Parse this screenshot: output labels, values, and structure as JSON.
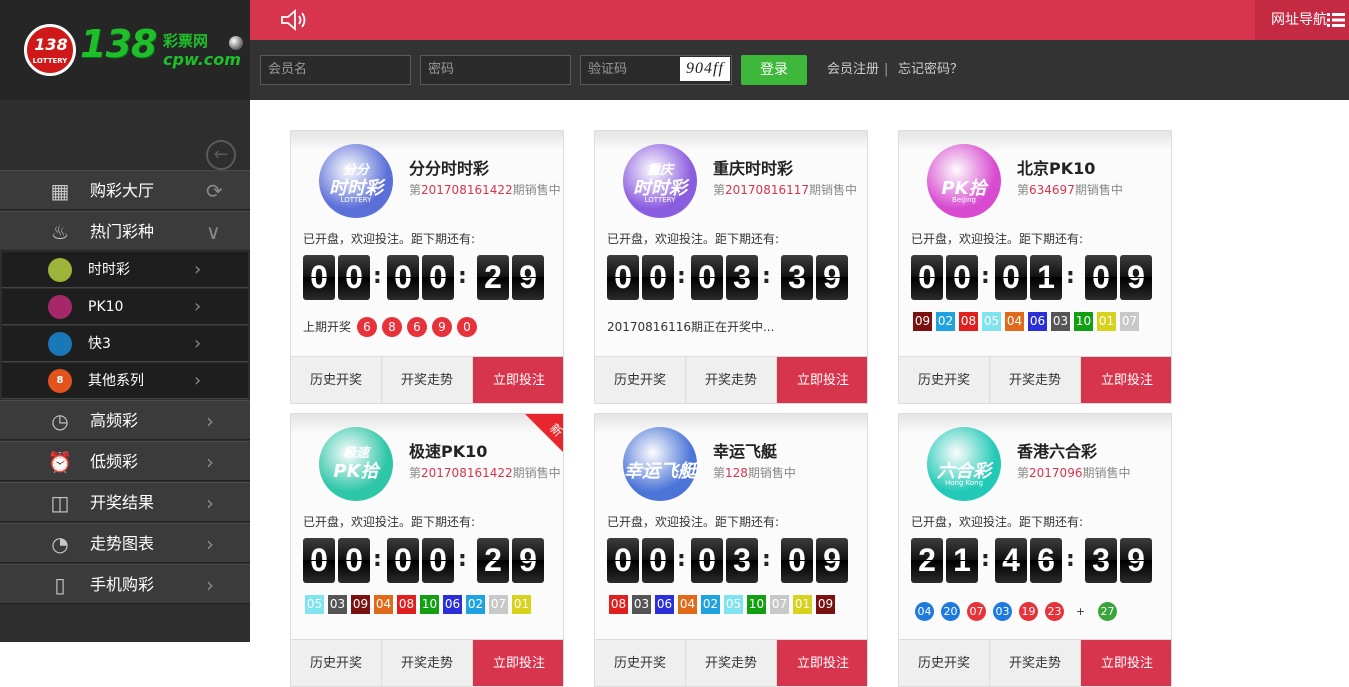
{
  "brand": {
    "disc_number": "138",
    "disc_text": "LOTTERY",
    "big_text": "138",
    "cn_text": "彩票网",
    "url_text": "cpw.com"
  },
  "sidebar": {
    "menu": [
      {
        "label": "购彩大厅",
        "icon": "grid-icon"
      },
      {
        "label": "热门彩种",
        "icon": "flame-icon"
      },
      {
        "label": "高频彩",
        "icon": "stopwatch-icon"
      },
      {
        "label": "低频彩",
        "icon": "alarm-clock-icon"
      },
      {
        "label": "开奖结果",
        "icon": "trophy-icon"
      },
      {
        "label": "走势图表",
        "icon": "trend-chart-icon"
      },
      {
        "label": "手机购彩",
        "icon": "mobile-phone-icon"
      }
    ],
    "submenu": [
      {
        "label": "时时彩",
        "icon": "ssc-ball-icon",
        "color": "#9db33a"
      },
      {
        "label": "PK10",
        "icon": "pk10-ball-icon",
        "color": "#a5286a"
      },
      {
        "label": "快3",
        "icon": "k3-ball-icon",
        "color": "#1b78b8"
      },
      {
        "label": "其他系列",
        "icon": "eight-ball-icon",
        "color": "#e2531d",
        "glyph": "8"
      }
    ]
  },
  "header": {
    "speaker_icon": "speaker-icon",
    "nav_label": "网址导航",
    "login": {
      "username_placeholder": "会员名",
      "password_placeholder": "密码",
      "captcha_placeholder": "验证码",
      "captcha_text": "904ff",
      "login_button": "登录",
      "register_link": "会员注册",
      "separator": "|",
      "forgot_link": "忘记密码？"
    }
  },
  "cards": [
    {
      "title": "分分时时彩",
      "issue_prefix": "第",
      "issue": "201708161422",
      "issue_suffix": "期销售中",
      "logo": {
        "line1": "分分",
        "line2": "时时彩",
        "line3": "LOTTERY",
        "color": "#5b6fd9"
      },
      "status": "已开盘，欢迎投注。距下期还有:",
      "countdown": [
        "0",
        "0",
        "0",
        "0",
        "2",
        "9"
      ],
      "prev_label": "上期开奖",
      "prev_balls": [
        "6",
        "8",
        "6",
        "9",
        "0"
      ],
      "buttons": [
        "历史开奖",
        "开奖走势",
        "立即投注"
      ]
    },
    {
      "title": "重庆时时彩",
      "issue_prefix": "第",
      "issue": "20170816117",
      "issue_suffix": "期销售中",
      "logo": {
        "line1": "重庆",
        "line2": "时时彩",
        "line3": "LOTTERY",
        "color": "#8a5ce0"
      },
      "status": "已开盘，欢迎投注。距下期还有:",
      "countdown": [
        "0",
        "0",
        "0",
        "3",
        "3",
        "9"
      ],
      "prev_text": "20170816116期正在开奖中...",
      "buttons": [
        "历史开奖",
        "开奖走势",
        "立即投注"
      ]
    },
    {
      "title": "北京PK10",
      "issue_prefix": "第",
      "issue": "634697",
      "issue_suffix": "期销售中",
      "logo": {
        "line1": "",
        "line2": "PK拾",
        "line3": "BeiJing",
        "color": "#d84ad0"
      },
      "status": "已开盘，欢迎投注。距下期还有:",
      "countdown": [
        "0",
        "0",
        "0",
        "1",
        "0",
        "9"
      ],
      "pk_balls": [
        {
          "n": "09",
          "c": "#7a1010"
        },
        {
          "n": "02",
          "c": "#1fa3e0"
        },
        {
          "n": "08",
          "c": "#e01f1f"
        },
        {
          "n": "05",
          "c": "#7fe3f0"
        },
        {
          "n": "04",
          "c": "#e06a1a"
        },
        {
          "n": "06",
          "c": "#2b2fd8"
        },
        {
          "n": "03",
          "c": "#555555"
        },
        {
          "n": "10",
          "c": "#12a012"
        },
        {
          "n": "01",
          "c": "#d8d21c"
        },
        {
          "n": "07",
          "c": "#c8c8c8"
        }
      ],
      "buttons": [
        "历史开奖",
        "开奖走势",
        "立即投注"
      ]
    },
    {
      "title": "极速PK10",
      "issue_prefix": "第",
      "issue": "201708161422",
      "issue_suffix": "期销售中",
      "logo": {
        "line1": "极速",
        "line2": "PK拾",
        "line3": "",
        "color": "#2ec6a8"
      },
      "ribbon": "新",
      "status": "已开盘，欢迎投注。距下期还有:",
      "countdown": [
        "0",
        "0",
        "0",
        "0",
        "2",
        "9"
      ],
      "pk_balls": [
        {
          "n": "05",
          "c": "#7fe3f0"
        },
        {
          "n": "03",
          "c": "#555555"
        },
        {
          "n": "09",
          "c": "#7a1010"
        },
        {
          "n": "04",
          "c": "#e06a1a"
        },
        {
          "n": "08",
          "c": "#e01f1f"
        },
        {
          "n": "10",
          "c": "#12a012"
        },
        {
          "n": "06",
          "c": "#2b2fd8"
        },
        {
          "n": "02",
          "c": "#1fa3e0"
        },
        {
          "n": "07",
          "c": "#c8c8c8"
        },
        {
          "n": "01",
          "c": "#d8d21c"
        }
      ],
      "buttons": [
        "历史开奖",
        "开奖走势",
        "立即投注"
      ]
    },
    {
      "title": "幸运飞艇",
      "issue_prefix": "第",
      "issue": "128",
      "issue_suffix": "期销售中",
      "logo": {
        "line1": "",
        "line2": "幸运飞艇",
        "line3": "",
        "color": "#4a74d8"
      },
      "status": "已开盘，欢迎投注。距下期还有:",
      "countdown": [
        "0",
        "0",
        "0",
        "3",
        "0",
        "9"
      ],
      "pk_balls": [
        {
          "n": "08",
          "c": "#e01f1f"
        },
        {
          "n": "03",
          "c": "#555555"
        },
        {
          "n": "06",
          "c": "#2b2fd8"
        },
        {
          "n": "04",
          "c": "#e06a1a"
        },
        {
          "n": "02",
          "c": "#1fa3e0"
        },
        {
          "n": "05",
          "c": "#7fe3f0"
        },
        {
          "n": "10",
          "c": "#12a012"
        },
        {
          "n": "07",
          "c": "#c8c8c8"
        },
        {
          "n": "01",
          "c": "#d8d21c"
        },
        {
          "n": "09",
          "c": "#7a1010"
        }
      ],
      "buttons": [
        "历史开奖",
        "开奖走势",
        "立即投注"
      ]
    },
    {
      "title": "香港六合彩",
      "issue_prefix": "第",
      "issue": "2017096",
      "issue_suffix": "期销售中",
      "logo": {
        "line1": "",
        "line2": "六合彩",
        "line3": "Hong Kong",
        "color": "#22c9b6"
      },
      "status": "已开盘，欢迎投注。距下期还有:",
      "countdown": [
        "2",
        "1",
        "4",
        "6",
        "3",
        "9"
      ],
      "hk_balls": [
        {
          "n": "04",
          "c": "#1f7ae0"
        },
        {
          "n": "20",
          "c": "#1f7ae0"
        },
        {
          "n": "07",
          "c": "#e8323a"
        },
        {
          "n": "03",
          "c": "#1f7ae0"
        },
        {
          "n": "19",
          "c": "#e8323a"
        },
        {
          "n": "23",
          "c": "#e8323a"
        }
      ],
      "hk_plus": "+",
      "hk_special": {
        "n": "27",
        "c": "#3aa53a"
      },
      "buttons": [
        "历史开奖",
        "开奖走势",
        "立即投注"
      ]
    }
  ]
}
